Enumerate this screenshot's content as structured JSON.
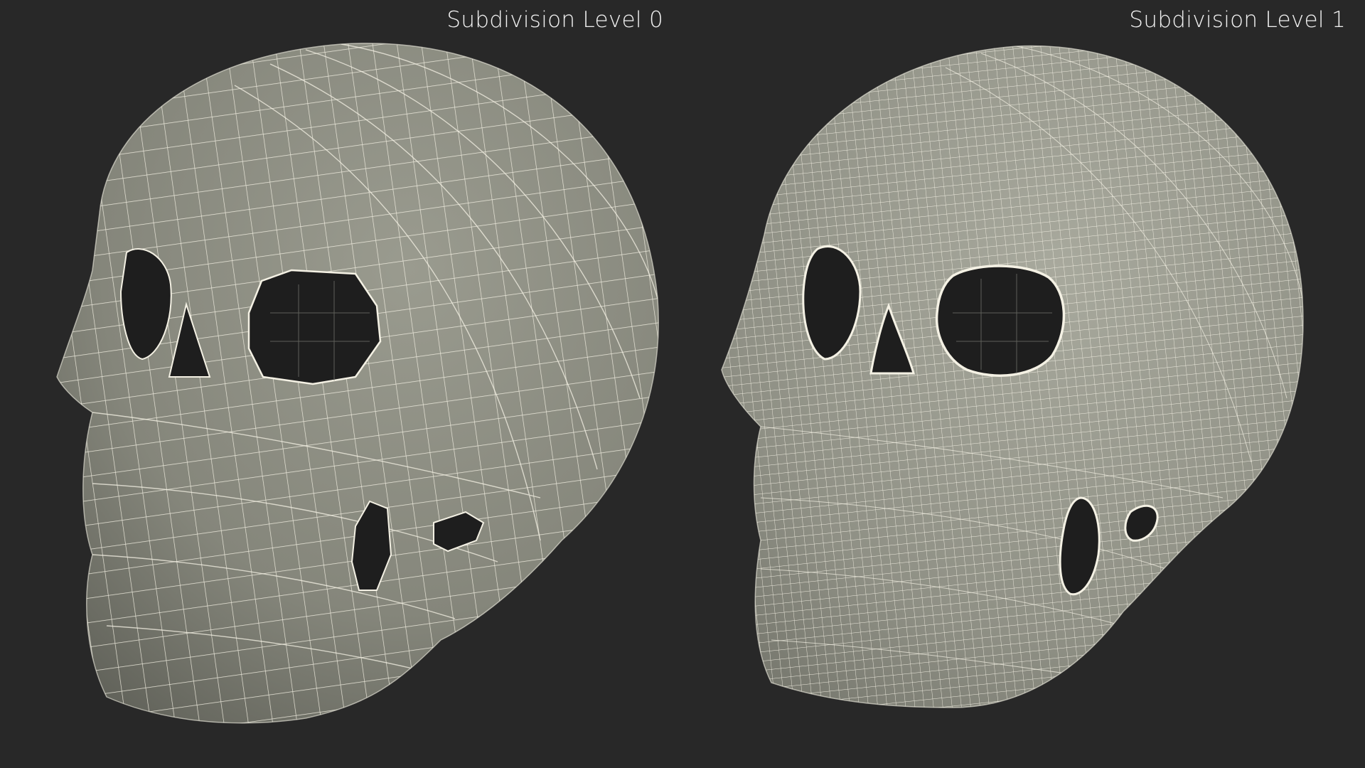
{
  "viewports": [
    {
      "caption": "Subdivision Level 0",
      "mesh_density": "low"
    },
    {
      "caption": "Subdivision Level 1",
      "mesh_density": "high"
    }
  ],
  "colors": {
    "background": "#282828",
    "mesh_fill": "#8e8f84",
    "mesh_shadow": "#5d5e56",
    "wire": "#f4f1e4",
    "hole": "#1e1e1e",
    "caption_text": "#f2f2f2"
  }
}
